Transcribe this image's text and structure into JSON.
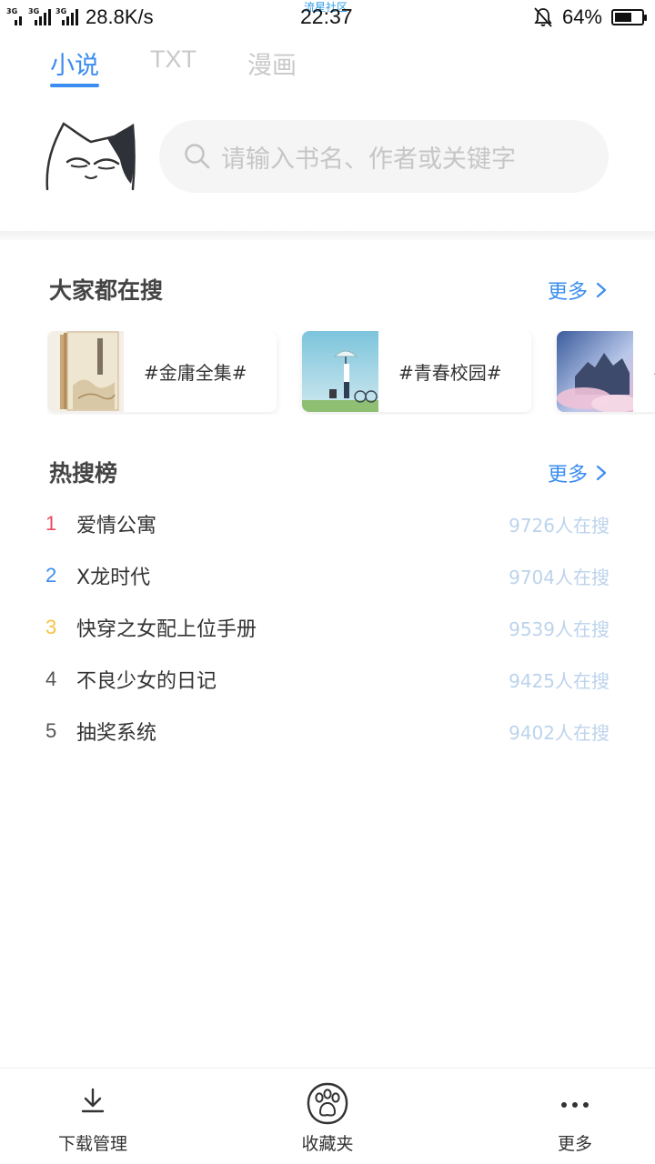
{
  "status_bar": {
    "network_1": "3G",
    "network_2": "3G",
    "network_3": "3G",
    "speed": "28.8K/s",
    "community_label": "流星社区",
    "time": "22:37",
    "battery_percent": "64%",
    "battery_level": 0.64
  },
  "tabs": [
    {
      "label": "小说",
      "active": true
    },
    {
      "label": "TXT",
      "active": false
    },
    {
      "label": "漫画",
      "active": false
    }
  ],
  "search": {
    "placeholder": "请输入书名、作者或关键字"
  },
  "popular": {
    "title": "大家都在搜",
    "more_label": "更多",
    "tags": [
      "#金庸全集#",
      "#青春校园#",
      "#"
    ]
  },
  "hot": {
    "title": "热搜榜",
    "more_label": "更多",
    "items": [
      {
        "rank": "1",
        "name": "爱情公寓",
        "count": "9726人在搜",
        "rank_color": "#e84a5f"
      },
      {
        "rank": "2",
        "name": "X龙时代",
        "count": "9704人在搜",
        "rank_color": "#3b8df0"
      },
      {
        "rank": "3",
        "name": "快穿之女配上位手册",
        "count": "9539人在搜",
        "rank_color": "#f5c342"
      },
      {
        "rank": "4",
        "name": "不良少女的日记",
        "count": "9425人在搜",
        "rank_color": "#555555"
      },
      {
        "rank": "5",
        "name": "抽奖系统",
        "count": "9402人在搜",
        "rank_color": "#555555"
      }
    ]
  },
  "bottom_nav": {
    "items": [
      {
        "label": "下载管理",
        "icon": "download-icon"
      },
      {
        "label": "收藏夹",
        "icon": "paw-icon"
      },
      {
        "label": "更多",
        "icon": "more-dots-icon"
      }
    ]
  },
  "colors": {
    "accent": "#3b8df0",
    "muted_count": "#bcd3ec",
    "placeholder": "#c6c6c6"
  }
}
